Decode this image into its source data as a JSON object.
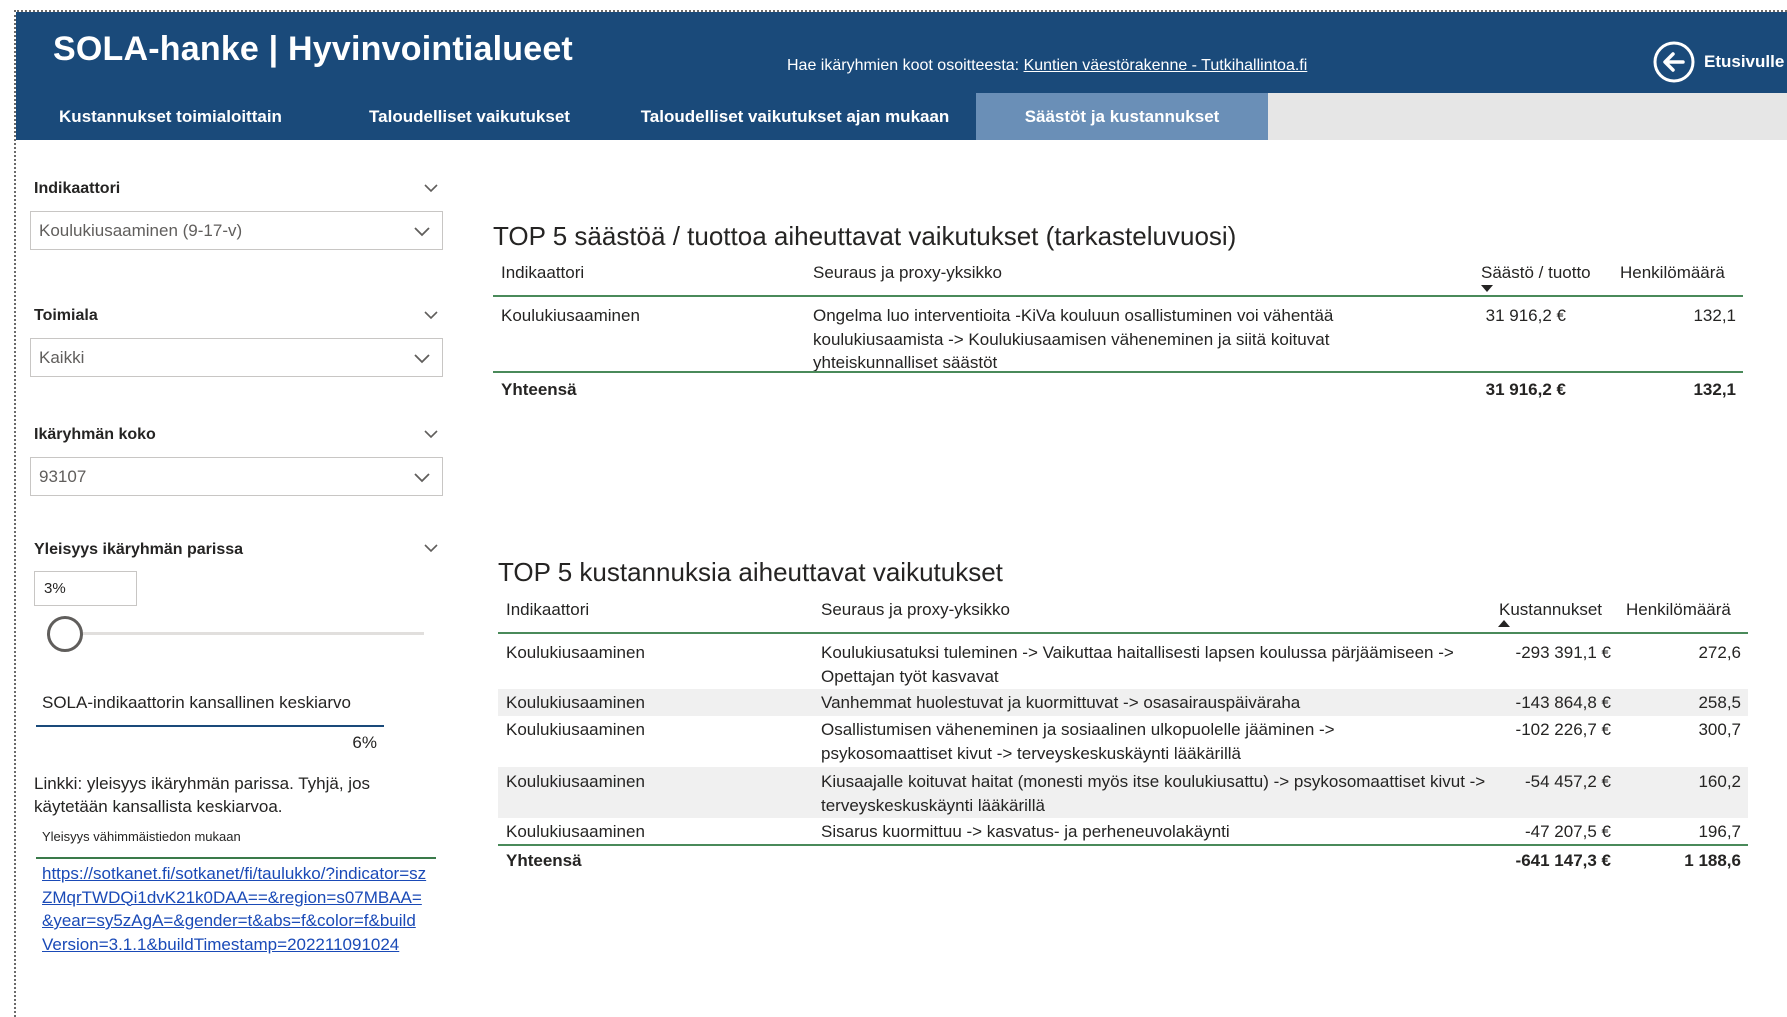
{
  "header": {
    "title": "SOLA-hanke | Hyvinvointialueet",
    "hint_prefix": "Hae ikäryhmien koot osoitteesta: ",
    "hint_link": "Kuntien väestörakenne - Tutkihallintoa.fi",
    "home_label": "Etusivulle"
  },
  "tabs": [
    {
      "label": "Kustannukset toimialoittain"
    },
    {
      "label": "Taloudelliset vaikutukset"
    },
    {
      "label": "Taloudelliset vaikutukset ajan mukaan"
    },
    {
      "label": "Säästöt ja kustannukset",
      "active": true
    }
  ],
  "filters": {
    "indicator": {
      "label": "Indikaattori",
      "value": "Koulukiusaaminen (9-17-v)"
    },
    "sector": {
      "label": "Toimiala",
      "value": "Kaikki"
    },
    "group_size": {
      "label": "Ikäryhmän koko",
      "value": "93107"
    },
    "prevalence": {
      "label": "Yleisyys ikäryhmän parissa",
      "value": "3%",
      "slider_fraction": 0.0
    }
  },
  "kpi": {
    "label": "SOLA-indikaattorin kansallinen keskiarvo",
    "value": "6%"
  },
  "notes": {
    "text": "Linkki: yleisyys ikäryhmän parissa. Tyhjä, jos käytetään kansallista keskiarvoa.",
    "small": "Yleisyys vähimmäistiedon mukaan",
    "link": "https://sotkanet.fi/sotkanet/fi/taulukko/?indicator=szZMqrTWDQi1dvK21k0DAA==&region=s07MBAA=&year=sy5zAgA=&gender=t&abs=f&color=f&buildVersion=3.1.1&buildTimestamp=202211091024"
  },
  "savings": {
    "title": "TOP 5 säästöä / tuottoa aiheuttavat vaikutukset (tarkasteluvuosi)",
    "columns": [
      "Indikaattori",
      "Seuraus ja proxy-yksikko",
      "Säästö / tuotto",
      "Henkilömäärä"
    ],
    "rows": [
      [
        "Koulukiusaaminen",
        "Ongelma luo interventioita -KiVa kouluun osallistuminen voi vähentää koulukiusaamista -> Koulukiusaamisen väheneminen ja siitä koituvat yhteiskunnalliset säästöt",
        "31 916,2 €",
        "132,1"
      ]
    ],
    "total": [
      "Yhteensä",
      "31 916,2 €",
      "132,1"
    ]
  },
  "costs": {
    "title": "TOP 5 kustannuksia aiheuttavat vaikutukset",
    "columns": [
      "Indikaattori",
      "Seuraus ja proxy-yksikko",
      "Kustannukset",
      "Henkilömäärä"
    ],
    "rows": [
      [
        "Koulukiusaaminen",
        "Koulukiusatuksi tuleminen -> Vaikuttaa haitallisesti lapsen koulussa pärjäämiseen -> Opettajan työt kasvavat",
        "-293 391,1 €",
        "272,6"
      ],
      [
        "Koulukiusaaminen",
        "Vanhemmat huolestuvat ja kuormittuvat -> osasairauspäiväraha",
        "-143 864,8 €",
        "258,5"
      ],
      [
        "Koulukiusaaminen",
        "Osallistumisen väheneminen ja sosiaalinen ulkopuolelle jääminen -> psykosomaattiset kivut -> terveyskeskuskäynti lääkärillä",
        "-102 226,7 €",
        "300,7"
      ],
      [
        "Koulukiusaaminen",
        "Kiusaajalle koituvat haitat (monesti myös itse koulukiusattu) -> psykosomaattiset kivut -> terveyskeskuskäynti lääkärillä",
        "-54 457,2 €",
        "160,2"
      ],
      [
        "Koulukiusaaminen",
        "Sisarus kuormittuu -> kasvatus- ja perheneuvolakäynti",
        "-47 207,5 €",
        "196,7"
      ]
    ],
    "total": [
      "Yhteensä",
      "-641 147,3 €",
      "1 188,6"
    ]
  },
  "colors": {
    "header_bg": "#1a4a7a",
    "tab_active": "#6a8fb7",
    "table_rule": "#4a8a5a",
    "link": "#1a4ab7"
  }
}
